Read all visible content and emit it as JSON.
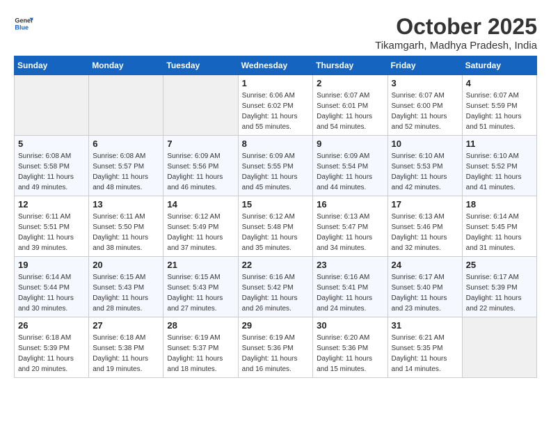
{
  "header": {
    "logo_line1": "General",
    "logo_line2": "Blue",
    "month": "October 2025",
    "location": "Tikamgarh, Madhya Pradesh, India"
  },
  "weekdays": [
    "Sunday",
    "Monday",
    "Tuesday",
    "Wednesday",
    "Thursday",
    "Friday",
    "Saturday"
  ],
  "weeks": [
    [
      {
        "day": "",
        "sunrise": "",
        "sunset": "",
        "daylight": "",
        "empty": true
      },
      {
        "day": "",
        "sunrise": "",
        "sunset": "",
        "daylight": "",
        "empty": true
      },
      {
        "day": "",
        "sunrise": "",
        "sunset": "",
        "daylight": "",
        "empty": true
      },
      {
        "day": "1",
        "sunrise": "Sunrise: 6:06 AM",
        "sunset": "Sunset: 6:02 PM",
        "daylight": "Daylight: 11 hours and 55 minutes.",
        "empty": false
      },
      {
        "day": "2",
        "sunrise": "Sunrise: 6:07 AM",
        "sunset": "Sunset: 6:01 PM",
        "daylight": "Daylight: 11 hours and 54 minutes.",
        "empty": false
      },
      {
        "day": "3",
        "sunrise": "Sunrise: 6:07 AM",
        "sunset": "Sunset: 6:00 PM",
        "daylight": "Daylight: 11 hours and 52 minutes.",
        "empty": false
      },
      {
        "day": "4",
        "sunrise": "Sunrise: 6:07 AM",
        "sunset": "Sunset: 5:59 PM",
        "daylight": "Daylight: 11 hours and 51 minutes.",
        "empty": false
      }
    ],
    [
      {
        "day": "5",
        "sunrise": "Sunrise: 6:08 AM",
        "sunset": "Sunset: 5:58 PM",
        "daylight": "Daylight: 11 hours and 49 minutes.",
        "empty": false
      },
      {
        "day": "6",
        "sunrise": "Sunrise: 6:08 AM",
        "sunset": "Sunset: 5:57 PM",
        "daylight": "Daylight: 11 hours and 48 minutes.",
        "empty": false
      },
      {
        "day": "7",
        "sunrise": "Sunrise: 6:09 AM",
        "sunset": "Sunset: 5:56 PM",
        "daylight": "Daylight: 11 hours and 46 minutes.",
        "empty": false
      },
      {
        "day": "8",
        "sunrise": "Sunrise: 6:09 AM",
        "sunset": "Sunset: 5:55 PM",
        "daylight": "Daylight: 11 hours and 45 minutes.",
        "empty": false
      },
      {
        "day": "9",
        "sunrise": "Sunrise: 6:09 AM",
        "sunset": "Sunset: 5:54 PM",
        "daylight": "Daylight: 11 hours and 44 minutes.",
        "empty": false
      },
      {
        "day": "10",
        "sunrise": "Sunrise: 6:10 AM",
        "sunset": "Sunset: 5:53 PM",
        "daylight": "Daylight: 11 hours and 42 minutes.",
        "empty": false
      },
      {
        "day": "11",
        "sunrise": "Sunrise: 6:10 AM",
        "sunset": "Sunset: 5:52 PM",
        "daylight": "Daylight: 11 hours and 41 minutes.",
        "empty": false
      }
    ],
    [
      {
        "day": "12",
        "sunrise": "Sunrise: 6:11 AM",
        "sunset": "Sunset: 5:51 PM",
        "daylight": "Daylight: 11 hours and 39 minutes.",
        "empty": false
      },
      {
        "day": "13",
        "sunrise": "Sunrise: 6:11 AM",
        "sunset": "Sunset: 5:50 PM",
        "daylight": "Daylight: 11 hours and 38 minutes.",
        "empty": false
      },
      {
        "day": "14",
        "sunrise": "Sunrise: 6:12 AM",
        "sunset": "Sunset: 5:49 PM",
        "daylight": "Daylight: 11 hours and 37 minutes.",
        "empty": false
      },
      {
        "day": "15",
        "sunrise": "Sunrise: 6:12 AM",
        "sunset": "Sunset: 5:48 PM",
        "daylight": "Daylight: 11 hours and 35 minutes.",
        "empty": false
      },
      {
        "day": "16",
        "sunrise": "Sunrise: 6:13 AM",
        "sunset": "Sunset: 5:47 PM",
        "daylight": "Daylight: 11 hours and 34 minutes.",
        "empty": false
      },
      {
        "day": "17",
        "sunrise": "Sunrise: 6:13 AM",
        "sunset": "Sunset: 5:46 PM",
        "daylight": "Daylight: 11 hours and 32 minutes.",
        "empty": false
      },
      {
        "day": "18",
        "sunrise": "Sunrise: 6:14 AM",
        "sunset": "Sunset: 5:45 PM",
        "daylight": "Daylight: 11 hours and 31 minutes.",
        "empty": false
      }
    ],
    [
      {
        "day": "19",
        "sunrise": "Sunrise: 6:14 AM",
        "sunset": "Sunset: 5:44 PM",
        "daylight": "Daylight: 11 hours and 30 minutes.",
        "empty": false
      },
      {
        "day": "20",
        "sunrise": "Sunrise: 6:15 AM",
        "sunset": "Sunset: 5:43 PM",
        "daylight": "Daylight: 11 hours and 28 minutes.",
        "empty": false
      },
      {
        "day": "21",
        "sunrise": "Sunrise: 6:15 AM",
        "sunset": "Sunset: 5:43 PM",
        "daylight": "Daylight: 11 hours and 27 minutes.",
        "empty": false
      },
      {
        "day": "22",
        "sunrise": "Sunrise: 6:16 AM",
        "sunset": "Sunset: 5:42 PM",
        "daylight": "Daylight: 11 hours and 26 minutes.",
        "empty": false
      },
      {
        "day": "23",
        "sunrise": "Sunrise: 6:16 AM",
        "sunset": "Sunset: 5:41 PM",
        "daylight": "Daylight: 11 hours and 24 minutes.",
        "empty": false
      },
      {
        "day": "24",
        "sunrise": "Sunrise: 6:17 AM",
        "sunset": "Sunset: 5:40 PM",
        "daylight": "Daylight: 11 hours and 23 minutes.",
        "empty": false
      },
      {
        "day": "25",
        "sunrise": "Sunrise: 6:17 AM",
        "sunset": "Sunset: 5:39 PM",
        "daylight": "Daylight: 11 hours and 22 minutes.",
        "empty": false
      }
    ],
    [
      {
        "day": "26",
        "sunrise": "Sunrise: 6:18 AM",
        "sunset": "Sunset: 5:39 PM",
        "daylight": "Daylight: 11 hours and 20 minutes.",
        "empty": false
      },
      {
        "day": "27",
        "sunrise": "Sunrise: 6:18 AM",
        "sunset": "Sunset: 5:38 PM",
        "daylight": "Daylight: 11 hours and 19 minutes.",
        "empty": false
      },
      {
        "day": "28",
        "sunrise": "Sunrise: 6:19 AM",
        "sunset": "Sunset: 5:37 PM",
        "daylight": "Daylight: 11 hours and 18 minutes.",
        "empty": false
      },
      {
        "day": "29",
        "sunrise": "Sunrise: 6:19 AM",
        "sunset": "Sunset: 5:36 PM",
        "daylight": "Daylight: 11 hours and 16 minutes.",
        "empty": false
      },
      {
        "day": "30",
        "sunrise": "Sunrise: 6:20 AM",
        "sunset": "Sunset: 5:36 PM",
        "daylight": "Daylight: 11 hours and 15 minutes.",
        "empty": false
      },
      {
        "day": "31",
        "sunrise": "Sunrise: 6:21 AM",
        "sunset": "Sunset: 5:35 PM",
        "daylight": "Daylight: 11 hours and 14 minutes.",
        "empty": false
      },
      {
        "day": "",
        "sunrise": "",
        "sunset": "",
        "daylight": "",
        "empty": true
      }
    ]
  ]
}
